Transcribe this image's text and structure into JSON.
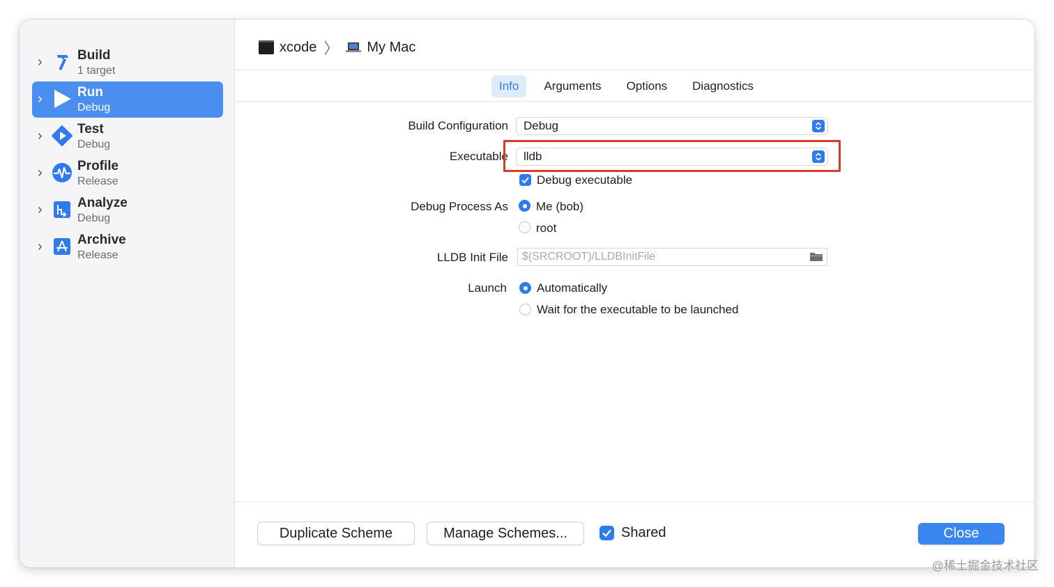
{
  "breadcrumb": {
    "target": "xcode",
    "destination": "My Mac"
  },
  "sidebar": {
    "items": [
      {
        "name": "Build",
        "sub": "1 target",
        "icon": "hammer-icon",
        "selected": false
      },
      {
        "name": "Run",
        "sub": "Debug",
        "icon": "play-icon",
        "selected": true
      },
      {
        "name": "Test",
        "sub": "Debug",
        "icon": "test-diamond-icon",
        "selected": false
      },
      {
        "name": "Profile",
        "sub": "Release",
        "icon": "waveform-icon",
        "selected": false
      },
      {
        "name": "Analyze",
        "sub": "Debug",
        "icon": "analyze-icon",
        "selected": false
      },
      {
        "name": "Archive",
        "sub": "Release",
        "icon": "archive-icon",
        "selected": false
      }
    ]
  },
  "tabs": [
    {
      "label": "Info",
      "active": true
    },
    {
      "label": "Arguments",
      "active": false
    },
    {
      "label": "Options",
      "active": false
    },
    {
      "label": "Diagnostics",
      "active": false
    }
  ],
  "form": {
    "build_configuration": {
      "label": "Build Configuration",
      "value": "Debug"
    },
    "executable": {
      "label": "Executable",
      "value": "lldb"
    },
    "debug_executable": {
      "label": "Debug executable",
      "checked": true
    },
    "debug_process_as": {
      "label": "Debug Process As",
      "options": [
        {
          "label": "Me (bob)",
          "selected": true
        },
        {
          "label": "root",
          "selected": false
        }
      ]
    },
    "lldb_init_file": {
      "label": "LLDB Init File",
      "value": "",
      "placeholder": "$(SRCROOT)/LLDBInitFile"
    },
    "launch": {
      "label": "Launch",
      "options": [
        {
          "label": "Automatically",
          "selected": true
        },
        {
          "label": "Wait for the executable to be launched",
          "selected": false
        }
      ]
    }
  },
  "footer": {
    "duplicate_label": "Duplicate Scheme",
    "manage_label": "Manage Schemes...",
    "shared_label": "Shared",
    "shared_checked": true,
    "close_label": "Close"
  },
  "watermark": "@稀土掘金技术社区",
  "colors": {
    "accent": "#2f7bed",
    "selection": "#4a8ef0",
    "highlight": "#d93b2b"
  }
}
